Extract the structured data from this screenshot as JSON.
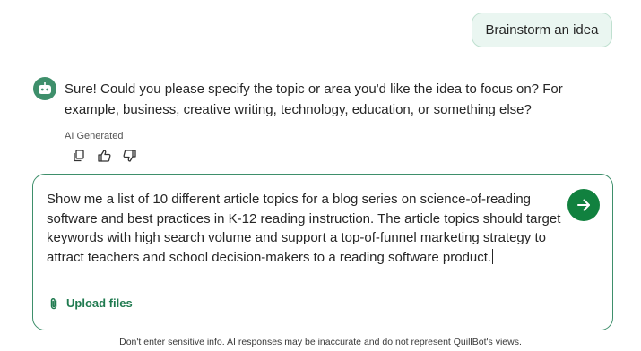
{
  "chat": {
    "user_message": "Brainstorm an idea",
    "bot_reply": "Sure! Could you please specify the topic or area you'd like the idea to focus on? For example, business, creative writing, technology, education, or something else?",
    "ai_label": "AI Generated",
    "actions": [
      {
        "icon": "copy-icon"
      },
      {
        "icon": "thumbs-up-icon"
      },
      {
        "icon": "thumbs-down-icon"
      }
    ]
  },
  "composer": {
    "value": "Show me a list of 10 different article topics for a blog series on science-of-reading software and best practices in K-12 reading instruction. The article topics should target keywords with high search volume and support a top-of-funnel marketing strategy to attract teachers and school decision-makers to a reading software product.",
    "upload_label": "Upload files",
    "send_icon": "arrow-right-icon"
  },
  "footer": {
    "disclaimer": "Don't enter sensitive info. AI responses may be inaccurate and do not represent QuillBot's views."
  },
  "colors": {
    "accent": "#11813f",
    "avatar": "#3e8f6b",
    "bubble_bg": "#eaf6f1",
    "upload_text": "#1f7a4f"
  }
}
